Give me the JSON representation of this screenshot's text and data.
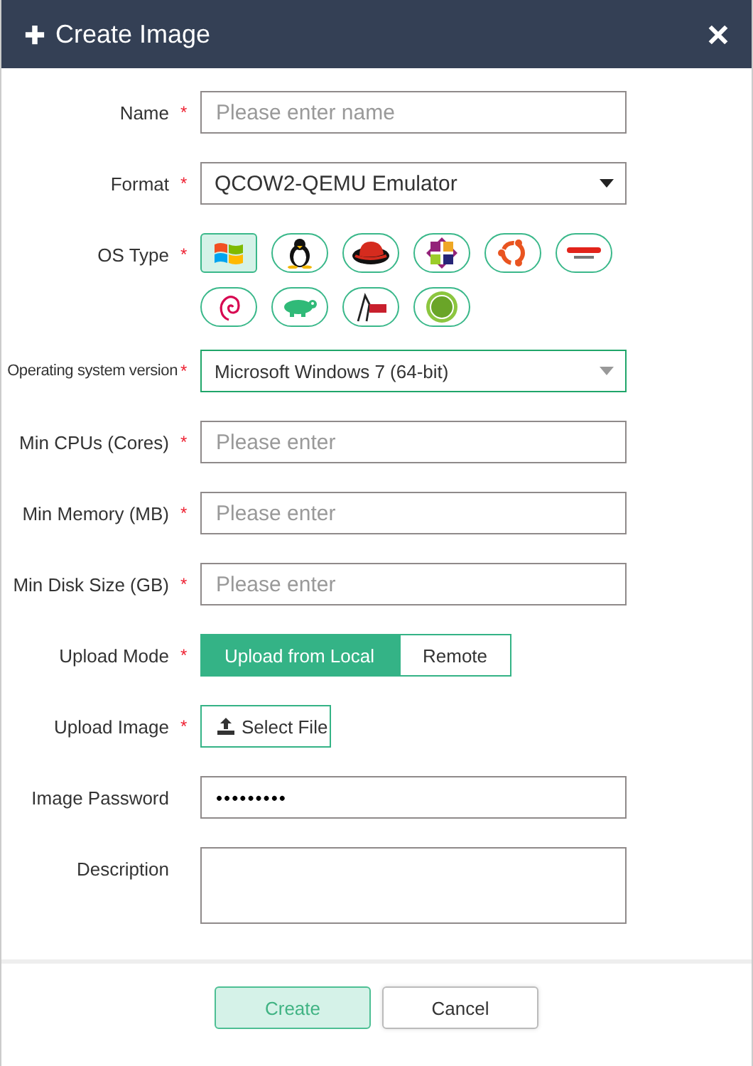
{
  "window": {
    "title": "Create Image"
  },
  "fields": [
    {
      "kind": "text",
      "label": "Name",
      "required_mark": "*",
      "placeholder": "Please enter name"
    },
    {
      "kind": "select",
      "label": "Format",
      "required_mark": "*",
      "value": "QCOW2-QEMU Emulator",
      "focused": false
    },
    {
      "kind": "os",
      "label": "OS Type",
      "required_mark": "*",
      "options": [
        {
          "kind": "windows",
          "selected": true
        },
        {
          "kind": "linux",
          "selected": false
        },
        {
          "kind": "redhat",
          "selected": false
        },
        {
          "kind": "centos",
          "selected": false
        },
        {
          "kind": "ubuntu",
          "selected": false
        },
        {
          "kind": "oracle",
          "selected": false
        },
        {
          "kind": "debian",
          "selected": false
        },
        {
          "kind": "suse",
          "selected": false
        },
        {
          "kind": "asianux",
          "selected": false
        },
        {
          "kind": "aix",
          "selected": false
        }
      ]
    },
    {
      "kind": "select",
      "label": "Operating system version",
      "required_mark": "*",
      "value": "Microsoft Windows 7 (64-bit)",
      "focused": true
    },
    {
      "kind": "text",
      "label": "Min CPUs (Cores)",
      "required_mark": "*",
      "placeholder": "Please enter"
    },
    {
      "kind": "text",
      "label": "Min Memory (MB)",
      "required_mark": "*",
      "placeholder": "Please enter"
    },
    {
      "kind": "text",
      "label": "Min Disk Size (GB)",
      "required_mark": "*",
      "placeholder": "Please enter"
    },
    {
      "kind": "toggle",
      "label": "Upload Mode",
      "required_mark": "*",
      "options": [
        {
          "label": "Upload from Local",
          "selected": true
        },
        {
          "label": "Remote",
          "selected": false
        }
      ]
    },
    {
      "kind": "file",
      "label": "Upload Image",
      "required_mark": "*",
      "button": "Select File"
    },
    {
      "kind": "password",
      "label": "Image Password",
      "value": "•••••••••"
    },
    {
      "kind": "textarea",
      "label": "Description"
    }
  ],
  "buttons": [
    {
      "label": "Create",
      "kind": "primary"
    },
    {
      "label": "Cancel",
      "kind": "default"
    }
  ]
}
